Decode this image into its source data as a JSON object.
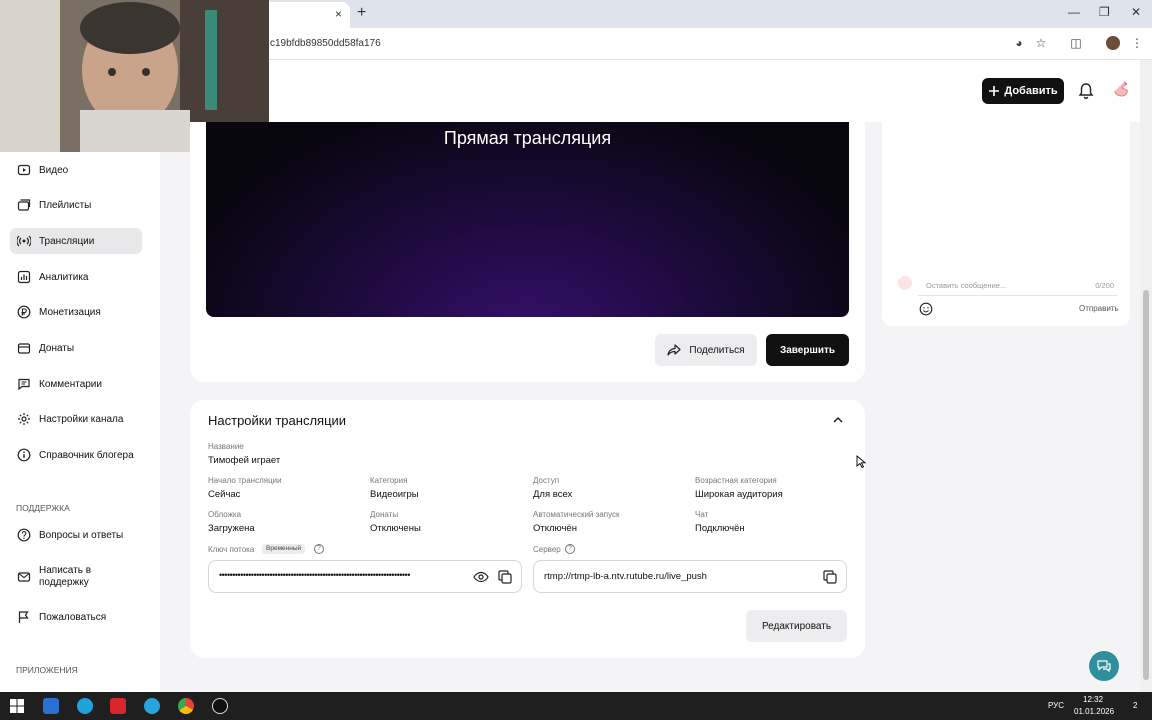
{
  "browser": {
    "url_fragment": "c19bfdb89850dd58fa176",
    "new_tab_label": "+",
    "tab_close": "×"
  },
  "header": {
    "add_button": "Добавить"
  },
  "sidebar": {
    "items": [
      {
        "label": "Видео",
        "icon": "video-icon"
      },
      {
        "label": "Плейлисты",
        "icon": "playlist-icon"
      },
      {
        "label": "Трансляции",
        "icon": "broadcast-icon"
      },
      {
        "label": "Аналитика",
        "icon": "analytics-icon"
      },
      {
        "label": "Монетизация",
        "icon": "ruble-icon"
      },
      {
        "label": "Донаты",
        "icon": "donate-icon"
      },
      {
        "label": "Комментарии",
        "icon": "comment-icon"
      },
      {
        "label": "Настройки канала",
        "icon": "gear-icon"
      },
      {
        "label": "Справочник блогера",
        "icon": "info-icon"
      }
    ],
    "support_section": "ПОДДЕРЖКА",
    "support_items": [
      {
        "label": "Вопросы и ответы",
        "icon": "help-icon"
      },
      {
        "label": "Написать в поддержку",
        "icon": "mail-icon"
      },
      {
        "label": "Пожаловаться",
        "icon": "flag-icon"
      }
    ],
    "apps_section": "ПРИЛОЖЕНИЯ"
  },
  "player": {
    "title": "Прямая трансляция",
    "share_button": "Поделиться",
    "finish_button": "Завершить"
  },
  "settings": {
    "title": "Настройки трансляции",
    "name_label": "Название",
    "name_value": "Тимофей играет",
    "start_label": "Начало трансляции",
    "start_value": "Сейчас",
    "category_label": "Категория",
    "category_value": "Видеоигры",
    "access_label": "Доступ",
    "access_value": "Для всех",
    "age_label": "Возрастная категория",
    "age_value": "Широкая аудитория",
    "cover_label": "Обложка",
    "cover_value": "Загружена",
    "donations_label": "Донаты",
    "donations_value": "Отключены",
    "autostart_label": "Автоматический запуск",
    "autostart_value": "Отключён",
    "chat_label": "Чат",
    "chat_value": "Подключён",
    "key_label": "Ключ потока",
    "key_badge": "Временный",
    "key_value": "••••••••••••••••••••••••••••••••••••••••••••••••••••••••••••••••••••••••",
    "server_label": "Сервер",
    "server_value": "rtmp://rtmp-lb-a.ntv.rutube.ru/live_push",
    "edit_button": "Редактировать"
  },
  "chat": {
    "placeholder": "Оставить сообщение...",
    "counter": "0/200",
    "send": "Отправить"
  },
  "taskbar": {
    "language": "РУС",
    "time": "12:32",
    "date": "01.01.2026",
    "notifications": "2"
  }
}
